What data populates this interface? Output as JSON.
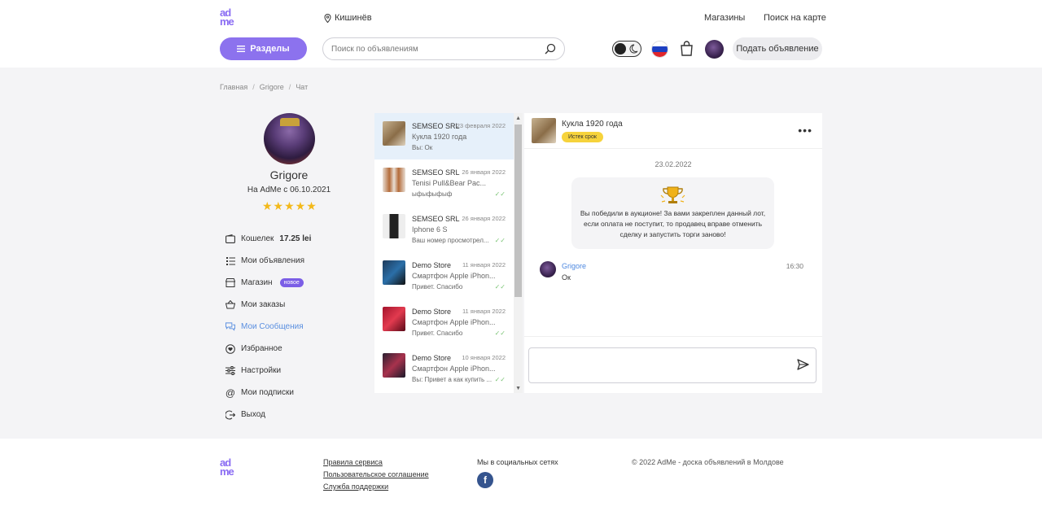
{
  "header": {
    "logo_top": "ad",
    "logo_bottom": "me",
    "city": "Кишинёв",
    "links": [
      "Магазины",
      "Поиск на карте"
    ],
    "sections_button": "Разделы",
    "search_placeholder": "Поиск по объявлениям",
    "post_button": "Подать объявление",
    "language_flag": "russian-flag"
  },
  "breadcrumb": [
    "Главная",
    "Grigore",
    "Чат"
  ],
  "profile": {
    "name": "Grigore",
    "since": "На AdMe с 06.10.2021",
    "rating_stars": "★★★★★"
  },
  "menu": {
    "wallet_label": "Кошелек",
    "wallet_value": "17.25 lei",
    "items": [
      "Мои объявления",
      "Магазин",
      "Мои заказы",
      "Мои Сообщения",
      "Избранное",
      "Настройки",
      "Мои подписки",
      "Выход"
    ],
    "new_badge": "новое"
  },
  "chats": [
    {
      "seller": "SEMSEO SRL",
      "date": "23 февраля 2022",
      "title": "Кукла 1920 года",
      "last": "Вы: Ок",
      "read": false
    },
    {
      "seller": "SEMSEO SRL",
      "date": "26 января 2022",
      "title": "Tenisi Pull&Bear Pac...",
      "last": "ыфыфыфыф",
      "read": true
    },
    {
      "seller": "SEMSEO SRL",
      "date": "26 января 2022",
      "title": "Iphone 6 S",
      "last": "Ваш номер просмотрел...",
      "read": true
    },
    {
      "seller": "Demo Store",
      "date": "11 января 2022",
      "title": "Смартфон Apple iPhon...",
      "last": "Привет. Спасибо",
      "read": true
    },
    {
      "seller": "Demo Store",
      "date": "11 января 2022",
      "title": "Смартфон Apple iPhon...",
      "last": "Привет. Спасибо",
      "read": true
    },
    {
      "seller": "Demo Store",
      "date": "10 января 2022",
      "title": "Смартфон Apple iPhon...",
      "last": "Вы: Привет а как купить ...",
      "read": true
    }
  ],
  "conversation": {
    "title": "Кукла 1920 года",
    "status": "Истек срок",
    "date": "23.02.2022",
    "notice": "Вы победили в аукционе! За вами закреплен данный лот, если оплата не поступит, то продавец вправе отменить сделку и запустить торги заново!",
    "message": {
      "author": "Grigore",
      "time": "16:30",
      "text": "Ок"
    },
    "input_placeholder": ""
  },
  "footer": {
    "links": [
      "Правила сервиса",
      "Пользовательское соглашение",
      "Служба поддержки"
    ],
    "social_title": "Мы в социальных сетях",
    "facebook_glyph": "f",
    "copyright": "© 2022 AdMe - доска объявлений в Молдове"
  },
  "colors": {
    "accent": "#8c72ee",
    "link_active": "#5a8fe0",
    "star": "#f3b91a",
    "expired_badge": "#f6d33c",
    "selected_chat": "#e6f0fa",
    "read_check": "#7cc576"
  }
}
